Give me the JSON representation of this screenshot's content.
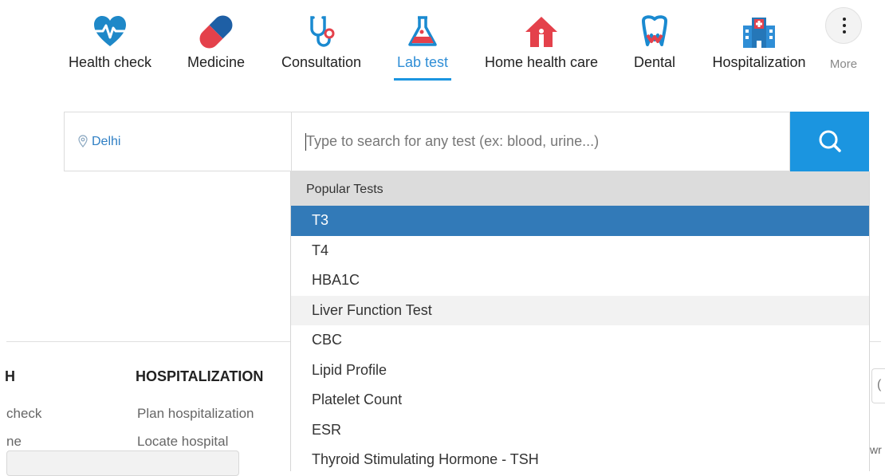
{
  "nav": {
    "items": [
      {
        "label": "Health check",
        "icon": "heart-pulse-icon"
      },
      {
        "label": "Medicine",
        "icon": "capsule-icon"
      },
      {
        "label": "Consultation",
        "icon": "stethoscope-icon"
      },
      {
        "label": "Lab test",
        "icon": "flask-icon",
        "active": true
      },
      {
        "label": "Home health care",
        "icon": "home-person-icon"
      },
      {
        "label": "Dental",
        "icon": "tooth-icon"
      },
      {
        "label": "Hospitalization",
        "icon": "hospital-icon"
      }
    ],
    "more_label": "More",
    "colors": {
      "heart": "#1e88c8",
      "pill_red": "#e4414b",
      "pill_dark": "#2c3e50",
      "blue": "#1a8ad0",
      "hospital": "#2f8ed6",
      "active": "#2f8ed6"
    }
  },
  "search": {
    "location": "Delhi",
    "placeholder": "Type to search for any test (ex: blood, urine...)",
    "button_icon": "search-icon",
    "button_color": "#1b95e0"
  },
  "dropdown": {
    "header": "Popular Tests",
    "items": [
      {
        "label": "T3"
      },
      {
        "label": "T4"
      },
      {
        "label": "HBA1C"
      },
      {
        "label": "Liver Function Test"
      },
      {
        "label": "CBC"
      },
      {
        "label": "Lipid Profile"
      },
      {
        "label": "Platelet Count"
      },
      {
        "label": "ESR"
      },
      {
        "label": "Thyroid Stimulating Hormone - TSH"
      }
    ],
    "selected_index": 0,
    "hovered_index": 3,
    "selected_color": "#327ab8"
  },
  "footer": {
    "col1_head": "H",
    "col1_items": [
      "check",
      "ne"
    ],
    "col2_head": "HOSPITALIZATION",
    "col2_items": [
      "Plan hospitalization",
      "Locate hospital"
    ],
    "right_snippet_1": "(",
    "right_snippet_2": "wr"
  }
}
